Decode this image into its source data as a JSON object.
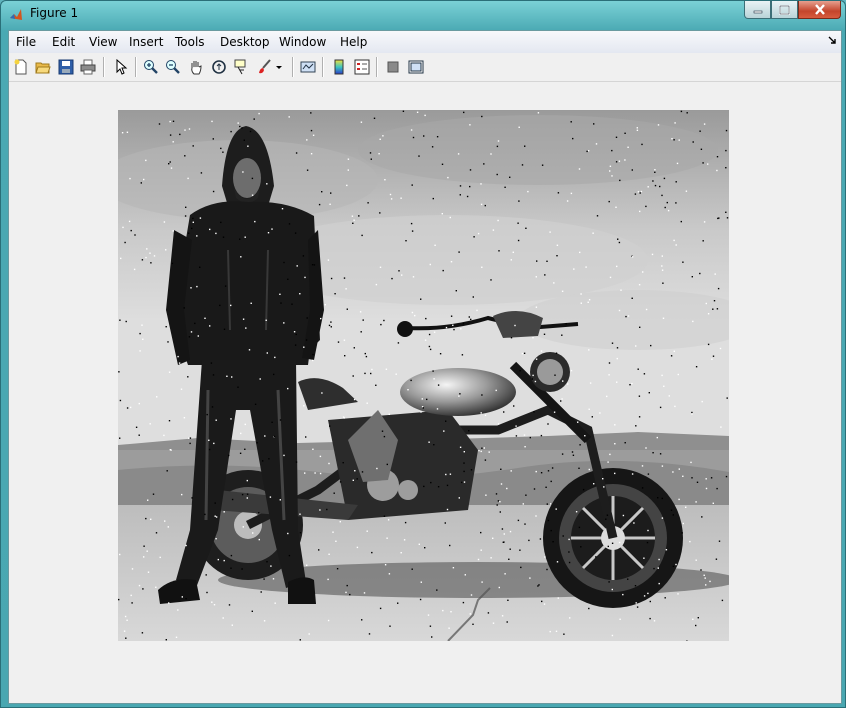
{
  "window": {
    "title": "Figure 1"
  },
  "menu": [
    "File",
    "Edit",
    "View",
    "Insert",
    "Tools",
    "Desktop",
    "Window",
    "Help"
  ],
  "toolbar": {
    "buttons": [
      "new-figure-icon",
      "open-file-icon",
      "save-icon",
      "print-icon",
      "arrow-pointer-icon",
      "zoom-in-icon",
      "zoom-out-icon",
      "pan-hand-icon",
      "rotate-3d-icon",
      "data-cursor-icon",
      "brush-icon",
      "dropdown-arrow-icon",
      "link-plot-icon",
      "colorbar-icon",
      "legend-icon",
      "hide-plot-tools-icon",
      "show-plot-tools-icon"
    ]
  },
  "figure": {
    "image": "grayscale photo of a man in a hooded leather jacket standing beside a motorcycle, with salt-and-pepper noise"
  },
  "colors": {
    "menu_bg": "#eef1f7",
    "figure_bg": "#f0f0f0",
    "frame": "#4aa9b3"
  }
}
